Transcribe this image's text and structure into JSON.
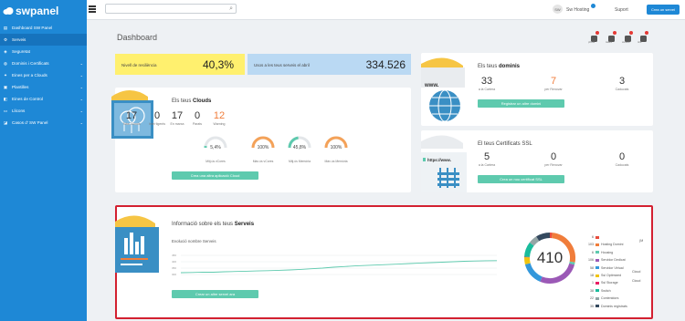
{
  "brand": {
    "name": "swpanel",
    "color": "#1e88d6"
  },
  "sidebar": {
    "items": [
      {
        "label": "Dashboard SW Panel",
        "icon": "dashboard-icon"
      },
      {
        "label": "Serveis",
        "icon": "gear-icon"
      },
      {
        "label": "Seguretat",
        "icon": "shield-icon"
      },
      {
        "label": "Dominis i Certificats",
        "icon": "globe-icon"
      },
      {
        "label": "Eines per a Clouds",
        "icon": "tools-icon"
      },
      {
        "label": "Plantilles",
        "icon": "template-icon"
      },
      {
        "label": "Eines de Control",
        "icon": "control-icon"
      },
      {
        "label": "Llicons",
        "icon": "license-icon"
      },
      {
        "label": "Casos d' SW Panel",
        "icon": "ticket-icon"
      }
    ]
  },
  "topbar": {
    "search_placeholder": "",
    "user_initials": "SW",
    "user_name": "Sw Hosting",
    "support": "Suport",
    "create_server": "Crea un servei"
  },
  "page_title": "Dashboard",
  "notifications": [
    {
      "label": "pbids"
    },
    {
      "label": "tasks"
    },
    {
      "label": "avisos"
    },
    {
      "label": "tick"
    }
  ],
  "risk": {
    "label": "Nivell de resiliència",
    "value": "40,3%",
    "color": "#fff06e"
  },
  "traffic": {
    "label": "Usos a les teus serveis el abril",
    "value": "334.526",
    "color": "#bad9f3"
  },
  "clouds": {
    "title_prefix": "Els teus ",
    "title_bold": "Clouds",
    "stats": [
      {
        "value": "17",
        "label": "Total Clouds"
      },
      {
        "value": "0",
        "label": "Intel·ligents"
      },
      {
        "value": "17",
        "label": "En marxa"
      },
      {
        "value": "0",
        "label": "Parats"
      },
      {
        "value": "12",
        "label": "Warning"
      }
    ],
    "gauges": [
      {
        "value": "5,4%",
        "label": "Mitj.ús vCores",
        "fraction": 0.054,
        "color": "#5ecaae"
      },
      {
        "value": "100%",
        "label": "Màx.ús vCores",
        "fraction": 1.0,
        "color": "#f4a259"
      },
      {
        "value": "45,8%",
        "label": "Mitj.ús Memòria",
        "fraction": 0.458,
        "color": "#5ecaae"
      },
      {
        "value": "100%",
        "label": "Màx.ús Memòria",
        "fraction": 1.0,
        "color": "#f4a259"
      }
    ],
    "button": "Crea una altra aplicació Cloud"
  },
  "domains": {
    "title_prefix": "Els teus ",
    "title_bold": "dominis",
    "stats": [
      {
        "value": "33",
        "label": "a la Cartera"
      },
      {
        "value": "7",
        "label": "per Renovar"
      },
      {
        "value": "3",
        "label": "Caducats"
      }
    ],
    "button": "Registrar un altre domini",
    "illustration_text": "www."
  },
  "ssl": {
    "title": "El teus Certificats SSL",
    "stats": [
      {
        "value": "5",
        "label": "a la Cartera"
      },
      {
        "value": "0",
        "label": "per Renovar"
      },
      {
        "value": "0",
        "label": "Caducats"
      }
    ],
    "button": "Crea un nou certificat SSL",
    "illustration_text": "https://www."
  },
  "services": {
    "title_prefix": "Informació sobre els teus ",
    "title_bold": "Serveis",
    "chart_label": "Evolució nombre Serveis",
    "total": "410",
    "button": "Crear un altre servei ara",
    "legend": [
      {
        "count": "6",
        "label": "",
        "color": "#e84c3d"
      },
      {
        "count": "103",
        "label": "Hosting Domini",
        "color": "#f07d3b"
      },
      {
        "count": "6",
        "label": "Housing",
        "color": "#5ecaae"
      },
      {
        "count": "106",
        "label": "Servidor Dedicat",
        "color": "#9b59b6"
      },
      {
        "count": "58",
        "label": "Servidor Virtual",
        "color": "#3498db"
      },
      {
        "count": "18",
        "label": "Ssl Optimized",
        "color": "#f1c40f"
      },
      {
        "count": "1",
        "label": "Ssl Storage",
        "color": "#e91e63"
      },
      {
        "count": "38",
        "label": "Switch",
        "color": "#1abc9c"
      },
      {
        "count": "22",
        "label": "Contenidors",
        "color": "#95a5a6"
      },
      {
        "count": "35",
        "label": "Dominis registrats",
        "color": "#34495e"
      }
    ],
    "legend_extra": [
      {
        "label": "(M"
      },
      {
        "label": "Cloud"
      },
      {
        "label": "Cloud"
      }
    ]
  },
  "chart_data": {
    "type": "area",
    "title": "",
    "xlabel": "",
    "ylabel": "",
    "ylim": [
      0,
      450
    ],
    "yticks": [
      "450",
      "400",
      "350",
      "300"
    ],
    "series": [
      {
        "values": [
          300,
          302,
          305,
          304,
          308,
          311,
          313,
          316,
          318,
          322,
          325,
          330,
          336,
          342,
          350,
          356,
          362,
          366,
          370,
          374,
          378,
          383,
          388,
          392,
          396,
          400,
          404,
          407,
          409,
          410
        ]
      }
    ]
  },
  "donut": {
    "segments": [
      {
        "value": 6,
        "color": "#e84c3d"
      },
      {
        "value": 103,
        "color": "#f07d3b"
      },
      {
        "value": 6,
        "color": "#5ecaae"
      },
      {
        "value": 106,
        "color": "#9b59b6"
      },
      {
        "value": 58,
        "color": "#3498db"
      },
      {
        "value": 18,
        "color": "#f1c40f"
      },
      {
        "value": 1,
        "color": "#e91e63"
      },
      {
        "value": 38,
        "color": "#1abc9c"
      },
      {
        "value": 22,
        "color": "#95a5a6"
      },
      {
        "value": 35,
        "color": "#34495e"
      }
    ]
  }
}
